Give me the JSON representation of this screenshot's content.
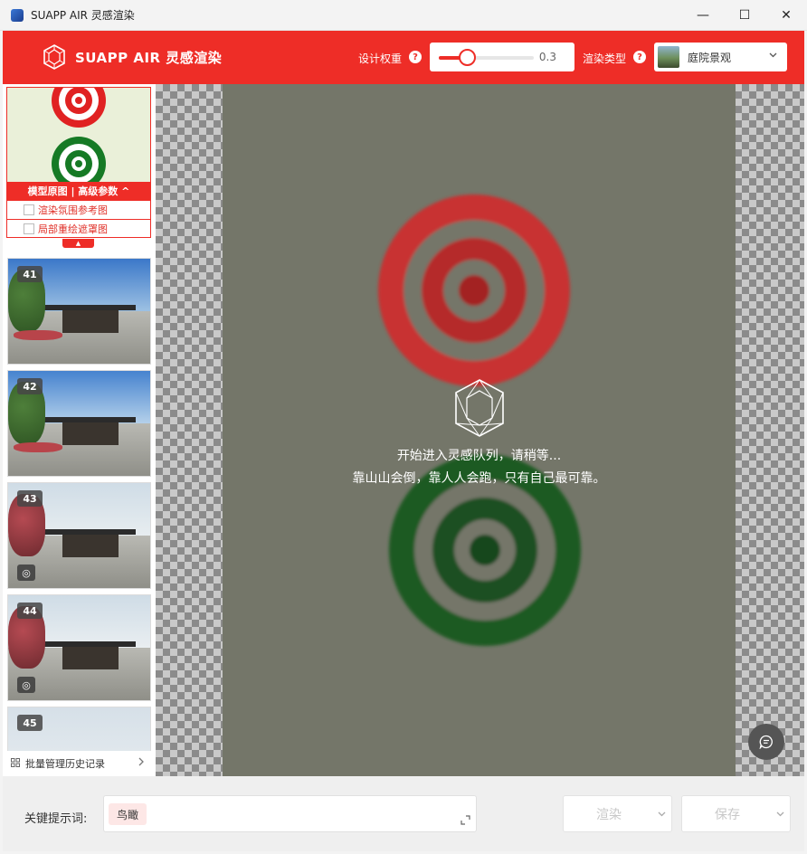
{
  "window": {
    "title": "SUAPP AIR 灵感渲染",
    "minimize_glyph": "—",
    "maximize_glyph": "☐",
    "close_glyph": "✕"
  },
  "header": {
    "brand": "SUAPP AIR 灵感渲染",
    "weight_label": "设计权重",
    "weight_value": "0.3",
    "weight_fraction": 0.3,
    "render_type_label": "渲染类型",
    "render_type_value": "庭院景观",
    "help_glyph": "?"
  },
  "colors": {
    "accent": "#ee2d27",
    "canvas_bg": "#747669"
  },
  "sidebar": {
    "model_bar_label": "模型原图 | 高级参数 ^",
    "options": [
      {
        "label": "渲染氛围参考图"
      },
      {
        "label": "局部重绘遮罩图"
      }
    ],
    "thumbnails": [
      {
        "number": "41",
        "has_palette": false
      },
      {
        "number": "42",
        "has_palette": false
      },
      {
        "number": "43",
        "has_palette": true
      },
      {
        "number": "44",
        "has_palette": true
      },
      {
        "number": "45",
        "has_palette": false
      }
    ],
    "batch_label": "批量管理历史记录"
  },
  "canvas": {
    "status_line1": "开始进入灵感队列，请稍等...",
    "status_line2": "靠山山会倒，靠人人会跑，只有自己最可靠。"
  },
  "bottom": {
    "keyword_label": "关键提示词:",
    "keyword_tag": "鸟瞰",
    "render_button": "渲染",
    "save_button": "保存"
  },
  "icons": {
    "logo": "gem-logo-icon",
    "help": "help-icon",
    "chevron": "chevron-down-icon",
    "grid": "grid-icon",
    "expand": "expand-icon",
    "chat": "chat-icon",
    "palette": "palette-icon"
  }
}
